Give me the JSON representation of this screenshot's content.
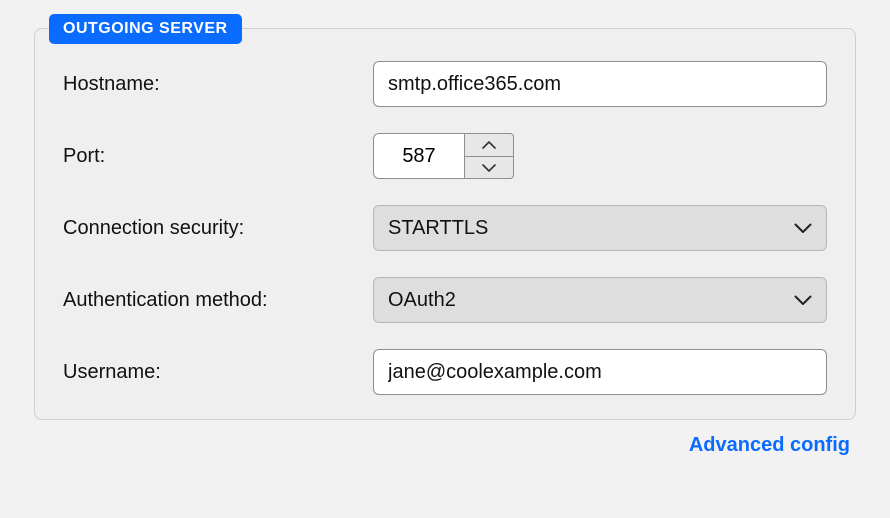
{
  "section": {
    "title": "OUTGOING SERVER"
  },
  "labels": {
    "hostname": "Hostname:",
    "port": "Port:",
    "connection_security": "Connection security:",
    "authentication_method": "Authentication method:",
    "username": "Username:"
  },
  "values": {
    "hostname": "smtp.office365.com",
    "port": "587",
    "connection_security": "STARTTLS",
    "authentication_method": "OAuth2",
    "username": "jane@coolexample.com"
  },
  "footer": {
    "advanced_config": "Advanced config"
  }
}
